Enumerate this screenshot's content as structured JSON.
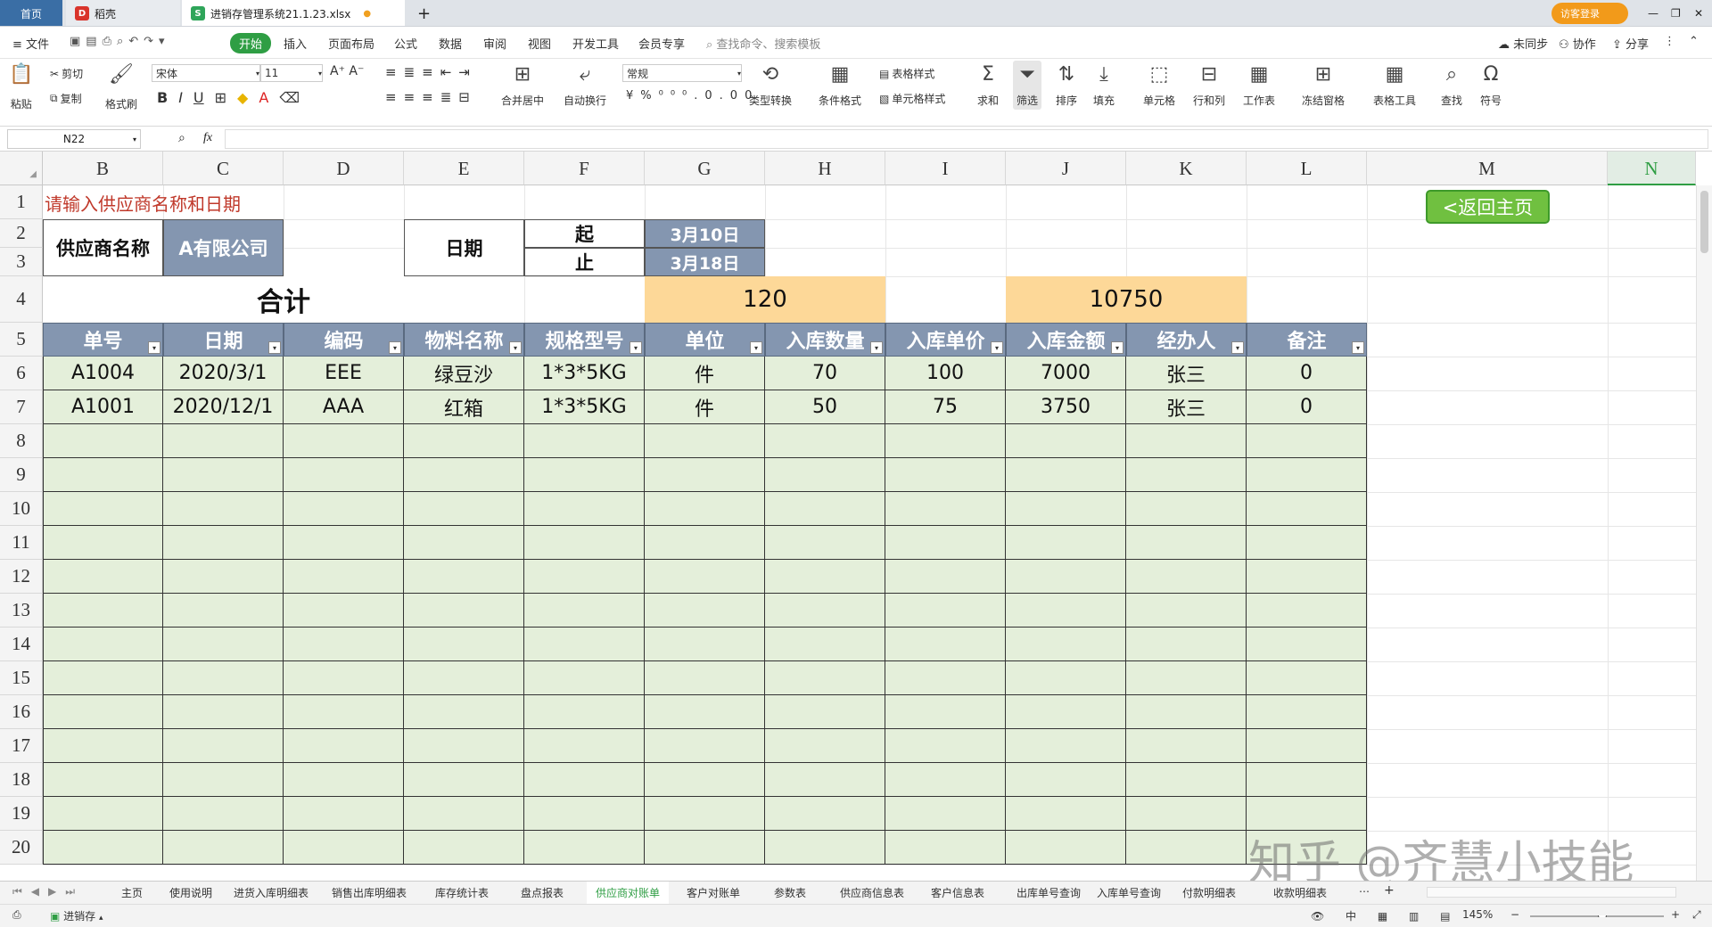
{
  "tabs": {
    "home": "首页",
    "daoke": "稻壳",
    "file": "进销存管理系统21.1.23.xlsx",
    "plus": "+",
    "visitor": "访客登录"
  },
  "menu": {
    "file": "≡ 文件",
    "items": [
      "开始",
      "插入",
      "页面布局",
      "公式",
      "数据",
      "审阅",
      "视图",
      "开发工具",
      "会员专享"
    ],
    "search": "查找命令、搜索模板",
    "sync": "未同步",
    "collab": "协作",
    "share": "分享"
  },
  "ribbon": {
    "paste": "粘贴",
    "cut": "剪切",
    "copy": "复制",
    "format_painter": "格式刷",
    "font": "宋体",
    "size": "11",
    "merge": "合并居中",
    "wrap": "自动换行",
    "numfmt": "常规",
    "convert": "类型转换",
    "cond": "条件格式",
    "table_style": "表格样式",
    "cell_style": "单元格样式",
    "sum": "求和",
    "filter": "筛选",
    "sort": "排序",
    "fill": "填充",
    "cell": "单元格",
    "rowcol": "行和列",
    "sheet": "工作表",
    "freeze": "冻结窗格",
    "tools": "表格工具",
    "find": "查找",
    "symbol": "符号"
  },
  "formula": {
    "namebox": "N22",
    "fx": "fx",
    "value": ""
  },
  "columns": [
    "B",
    "C",
    "D",
    "E",
    "F",
    "G",
    "H",
    "I",
    "J",
    "K",
    "L",
    "M",
    "N"
  ],
  "rows": [
    "1",
    "2",
    "3",
    "4",
    "5",
    "6",
    "7",
    "8",
    "9",
    "10",
    "11",
    "12",
    "13",
    "14",
    "15",
    "16",
    "17",
    "18",
    "19",
    "20"
  ],
  "sheet": {
    "prompt": "请输入供应商名称和日期",
    "back_button": "<返回主页",
    "supplier_label": "供应商名称",
    "supplier_value": "A有限公司",
    "date_label": "日期",
    "start_label": "起",
    "start_value": "3月10日",
    "end_label": "止",
    "end_value": "3月18日",
    "total_label": "合计",
    "total_qty": "120",
    "total_amount": "10750"
  },
  "table": {
    "headers": [
      "单号",
      "日期",
      "编码",
      "物料名称",
      "规格型号",
      "单位",
      "入库数量",
      "入库单价",
      "入库金额",
      "经办人",
      "备注"
    ],
    "rows": [
      [
        "A1004",
        "2020/3/1",
        "EEE",
        "绿豆沙",
        "1*3*5KG",
        "件",
        "70",
        "100",
        "7000",
        "张三",
        "0"
      ],
      [
        "A1001",
        "2020/12/1",
        "AAA",
        "红箱",
        "1*3*5KG",
        "件",
        "50",
        "75",
        "3750",
        "张三",
        "0"
      ]
    ]
  },
  "sheet_tabs": [
    "主页",
    "使用说明",
    "进货入库明细表",
    "销售出库明细表",
    "库存统计表",
    "盘点报表",
    "供应商对账单",
    "客户对账单",
    "参数表",
    "供应商信息表",
    "客户信息表",
    "出库单号查询",
    "入库单号查询",
    "付款明细表",
    "收款明细表"
  ],
  "active_sheet": "供应商对账单",
  "status": {
    "doc": "进销存",
    "zoom": "145%"
  },
  "watermark": "知乎 @齐慧小技能",
  "colors": {
    "header": "#8496b0",
    "data": "#e4efda",
    "total": "#fdd898",
    "accent": "#2f9e44",
    "prompt": "#c0392b"
  }
}
